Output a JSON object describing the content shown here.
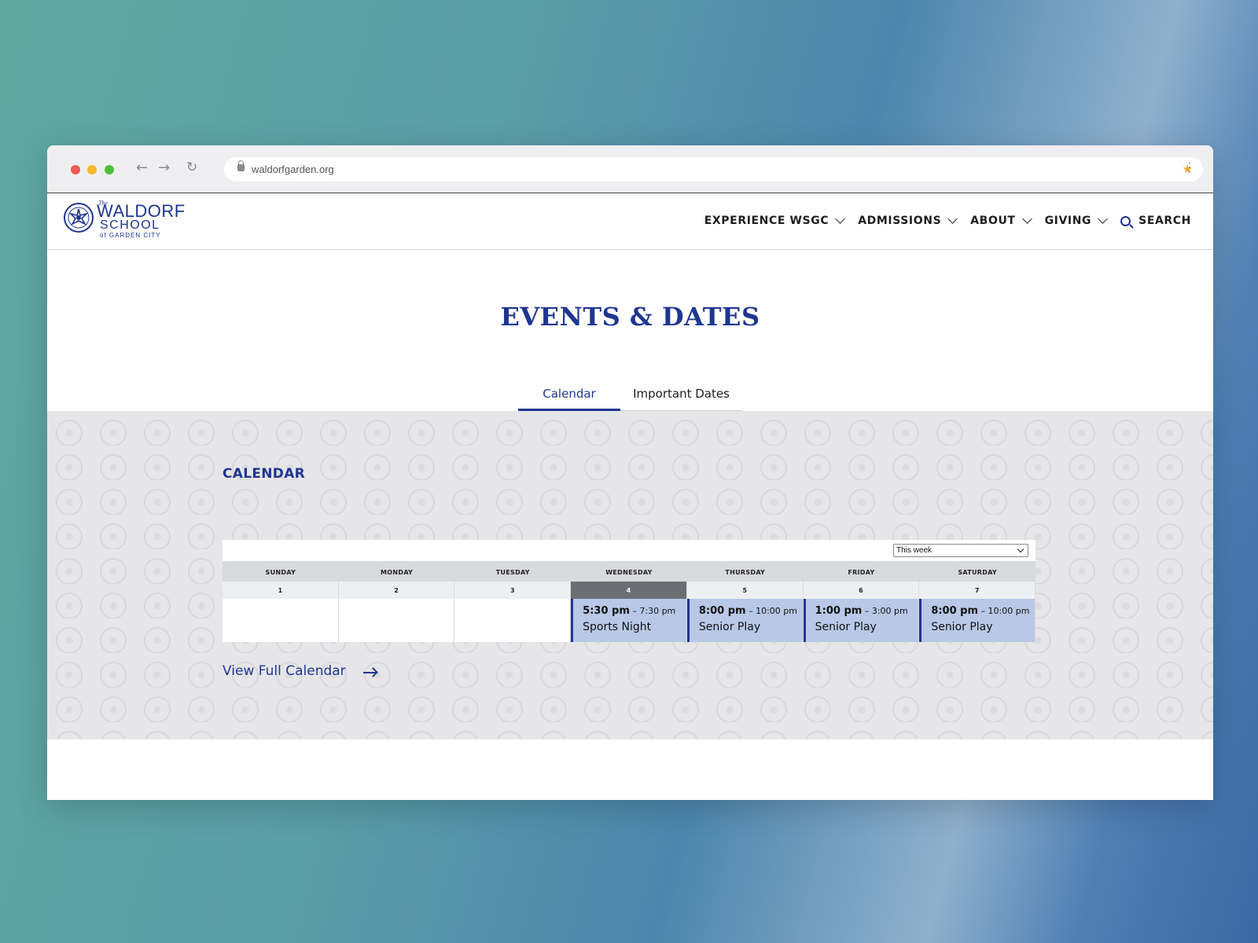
{
  "browser": {
    "url": "waldorfgarden.org"
  },
  "logo": {
    "the": "The",
    "line1": "WALDORF",
    "line2": "SCHOOL",
    "line3": "of GARDEN CITY"
  },
  "nav": {
    "items": [
      {
        "label": "EXPERIENCE WSGC"
      },
      {
        "label": "ADMISSIONS"
      },
      {
        "label": "ABOUT"
      },
      {
        "label": "GIVING"
      }
    ],
    "search_label": "SEARCH"
  },
  "page": {
    "title": "EVENTS & DATES",
    "tabs": [
      {
        "label": "Calendar",
        "active": true
      },
      {
        "label": "Important Dates",
        "active": false
      }
    ]
  },
  "calendar": {
    "section_title": "CALENDAR",
    "range_select": "This week",
    "days": [
      {
        "name": "SUNDAY",
        "num": "1"
      },
      {
        "name": "MONDAY",
        "num": "2"
      },
      {
        "name": "TUESDAY",
        "num": "3"
      },
      {
        "name": "WEDNESDAY",
        "num": "4",
        "today": true
      },
      {
        "name": "THURSDAY",
        "num": "5"
      },
      {
        "name": "FRIDAY",
        "num": "6"
      },
      {
        "name": "SATURDAY",
        "num": "7"
      }
    ],
    "events": [
      {
        "day": 3,
        "start": "5:30 pm",
        "end": "7:30 pm",
        "title": "Sports Night"
      },
      {
        "day": 4,
        "start": "8:00 pm",
        "end": "10:00 pm",
        "title": "Senior Play"
      },
      {
        "day": 5,
        "start": "1:00 pm",
        "end": "3:00 pm",
        "title": "Senior Play"
      },
      {
        "day": 6,
        "start": "8:00 pm",
        "end": "10:00 pm",
        "title": "Senior Play"
      }
    ],
    "view_full_label": "View Full Calendar"
  },
  "colors": {
    "brand_blue": "#1f3691",
    "event_bg": "#b8c8e6",
    "today_bg": "#6b6e73"
  }
}
